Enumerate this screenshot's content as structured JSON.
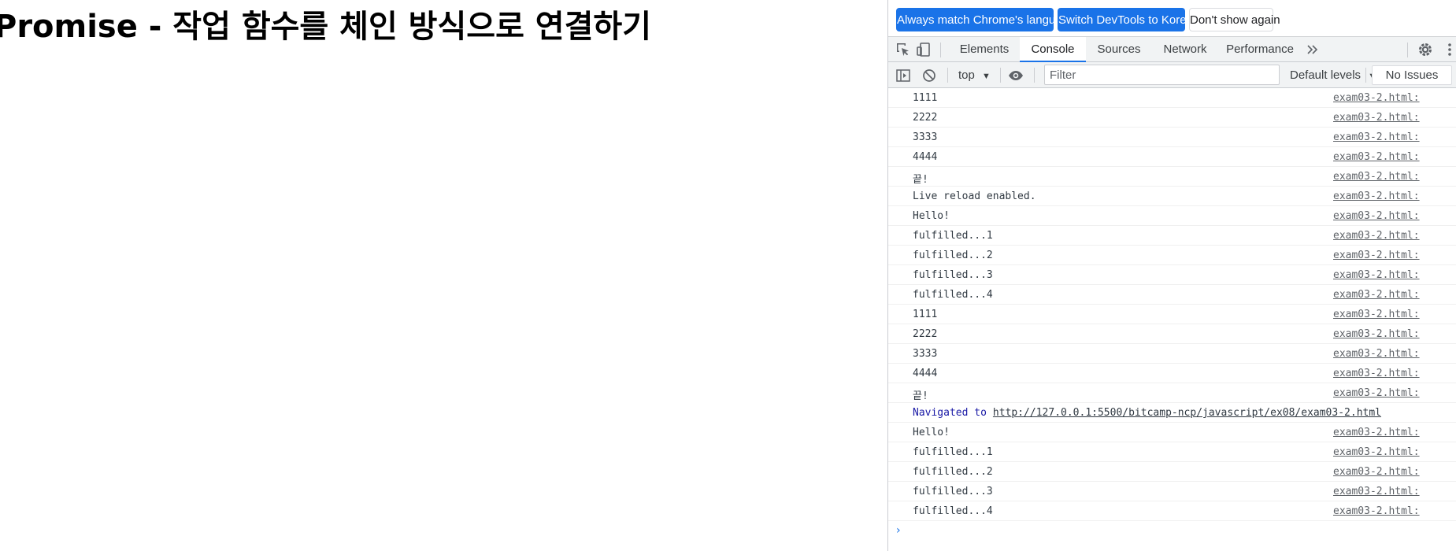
{
  "page": {
    "title": "Promise - 작업 함수를 체인 방식으로 연결하기"
  },
  "devtools": {
    "infobar": {
      "match_language": "Always match Chrome's language",
      "switch_language": "Switch DevTools to Korean",
      "dont_show": "Don't show again"
    },
    "tabs": [
      "Elements",
      "Console",
      "Sources",
      "Network",
      "Performance"
    ],
    "active_tab": "Console",
    "more_tabs_icon": "double-chevron-right-icon",
    "toolbar": {
      "context": "top",
      "filter_placeholder": "Filter",
      "filter_value": "",
      "levels": "Default levels",
      "issues": "No Issues"
    },
    "colors": {
      "accent": "#1a73e8",
      "navigated_text": "#1a1aa6",
      "toolbar_bg": "#f1f3f4"
    },
    "logs": [
      {
        "msg": "1111",
        "src": "exam03-2.html:"
      },
      {
        "msg": "2222",
        "src": "exam03-2.html:"
      },
      {
        "msg": "3333",
        "src": "exam03-2.html:"
      },
      {
        "msg": "4444",
        "src": "exam03-2.html:"
      },
      {
        "msg": "끝!",
        "src": "exam03-2.html:"
      },
      {
        "msg": "Live reload enabled.",
        "src": "exam03-2.html:"
      },
      {
        "msg": "Hello!",
        "src": "exam03-2.html:"
      },
      {
        "msg": "fulfilled...1",
        "src": "exam03-2.html:"
      },
      {
        "msg": "fulfilled...2",
        "src": "exam03-2.html:"
      },
      {
        "msg": "fulfilled...3",
        "src": "exam03-2.html:"
      },
      {
        "msg": "fulfilled...4",
        "src": "exam03-2.html:"
      },
      {
        "msg": "1111",
        "src": "exam03-2.html:"
      },
      {
        "msg": "2222",
        "src": "exam03-2.html:"
      },
      {
        "msg": "3333",
        "src": "exam03-2.html:"
      },
      {
        "msg": "4444",
        "src": "exam03-2.html:"
      },
      {
        "msg": "끝!",
        "src": "exam03-2.html:"
      }
    ],
    "navigated": {
      "text": "Navigated to",
      "url": "http://127.0.0.1:5500/bitcamp-ncp/javascript/ex08/exam03-2.html"
    },
    "logs_after": [
      {
        "msg": "Hello!",
        "src": "exam03-2.html:"
      },
      {
        "msg": "fulfilled...1",
        "src": "exam03-2.html:"
      },
      {
        "msg": "fulfilled...2",
        "src": "exam03-2.html:"
      },
      {
        "msg": "fulfilled...3",
        "src": "exam03-2.html:"
      },
      {
        "msg": "fulfilled...4",
        "src": "exam03-2.html:"
      }
    ],
    "prompt_icon": "chevron-right-icon"
  }
}
